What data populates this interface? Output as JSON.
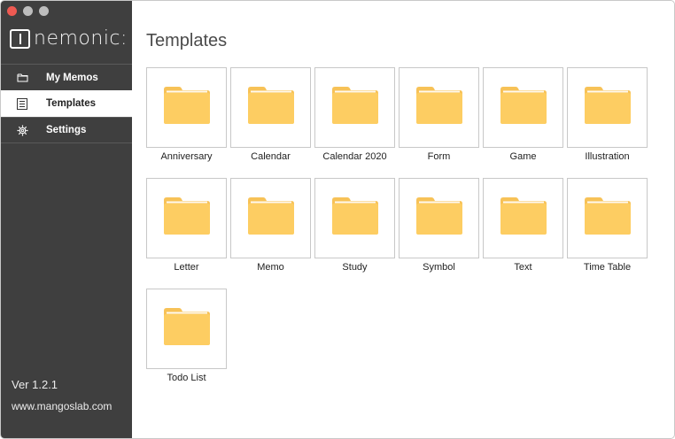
{
  "window": {
    "controls": [
      "close",
      "minimize",
      "zoom"
    ]
  },
  "brand": {
    "logo_text": "nemonic:"
  },
  "sidebar": {
    "items": [
      {
        "label": "My Memos",
        "icon": "folder-icon",
        "active": false
      },
      {
        "label": "Templates",
        "icon": "list-icon",
        "active": true
      },
      {
        "label": "Settings",
        "icon": "gear-icon",
        "active": false
      }
    ],
    "version": "Ver 1.2.1",
    "website": "www.mangoslab.com"
  },
  "main": {
    "title": "Templates",
    "templates": [
      "Anniversary",
      "Calendar",
      "Calendar 2020",
      "Form",
      "Game",
      "Illustration",
      "Letter",
      "Memo",
      "Study",
      "Symbol",
      "Text",
      "Time Table",
      "Todo List"
    ]
  },
  "colors": {
    "sidebar_bg": "#3f3f3f",
    "folder": "#fdcd62",
    "folder_tab": "#f7c257",
    "close_button": "#ee5a52"
  }
}
